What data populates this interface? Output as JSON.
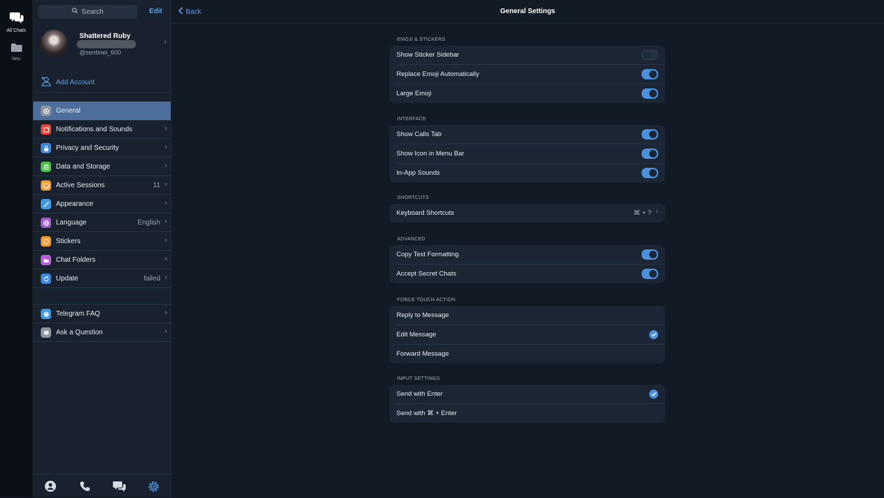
{
  "rail": {
    "all_chats_label": "All Chats",
    "folder_label": "Neu"
  },
  "sidebar": {
    "search_placeholder": "Search",
    "edit_label": "Edit",
    "profile": {
      "name": "Shattered Ruby",
      "username": "@sentinel_600"
    },
    "add_account_label": "Add Account",
    "items": [
      {
        "label": "General",
        "icon": "gear-icon",
        "color": "#8e96a0",
        "value": "",
        "active": true
      },
      {
        "label": "Notifications and Sounds",
        "icon": "bell-icon",
        "color": "#e5473d",
        "value": ""
      },
      {
        "label": "Privacy and Security",
        "icon": "lock-icon",
        "color": "#3d86e0",
        "value": ""
      },
      {
        "label": "Data and Storage",
        "icon": "database-icon",
        "color": "#4cc24a",
        "value": ""
      },
      {
        "label": "Active Sessions",
        "icon": "monitor-icon",
        "color": "#f29b2e",
        "value": "11"
      },
      {
        "label": "Appearance",
        "icon": "brush-icon",
        "color": "#3f9be0",
        "value": ""
      },
      {
        "label": "Language",
        "icon": "globe-icon",
        "color": "#a55ccf",
        "value": "English"
      },
      {
        "label": "Stickers",
        "icon": "sticker-icon",
        "color": "#f29b2e",
        "value": ""
      },
      {
        "label": "Chat Folders",
        "icon": "folder-icon",
        "color": "#b65fd6",
        "value": ""
      },
      {
        "label": "Update",
        "icon": "refresh-icon",
        "color": "#3d86e0",
        "value": "failed"
      }
    ],
    "help_items": [
      {
        "label": "Telegram FAQ",
        "icon": "question-icon",
        "color": "#3f9be0"
      },
      {
        "label": "Ask a Question",
        "icon": "chat-bubble-icon",
        "color": "#8e96a0"
      }
    ]
  },
  "header": {
    "back_label": "Back",
    "title": "General Settings"
  },
  "sections": {
    "emoji": {
      "title": "EMOJI & STICKERS",
      "rows": [
        {
          "label": "Show Sticker Sidebar",
          "on": false
        },
        {
          "label": "Replace Emoji Automatically",
          "on": true
        },
        {
          "label": "Large Emoji",
          "on": true
        }
      ]
    },
    "interface": {
      "title": "INTERFACE",
      "rows": [
        {
          "label": "Show Calls Tab",
          "on": true
        },
        {
          "label": "Show Icon in Menu Bar",
          "on": true
        },
        {
          "label": "In-App Sounds",
          "on": true
        }
      ]
    },
    "shortcuts": {
      "title": "SHORTCUTS",
      "row_label": "Keyboard Shortcuts",
      "row_value": "⌘ + ?"
    },
    "advanced": {
      "title": "ADVANCED",
      "rows": [
        {
          "label": "Copy Text Formatting",
          "on": true
        },
        {
          "label": "Accept Secret Chats",
          "on": true
        }
      ]
    },
    "force_touch": {
      "title": "FORCE TOUCH ACTION",
      "rows": [
        {
          "label": "Reply to Message",
          "checked": false
        },
        {
          "label": "Edit Message",
          "checked": true
        },
        {
          "label": "Forward Message",
          "checked": false
        }
      ]
    },
    "input": {
      "title": "INPUT SETTINGS",
      "rows": [
        {
          "label": "Send with Enter",
          "checked": true
        },
        {
          "label": "Send with ⌘ + Enter",
          "checked": false
        }
      ]
    }
  },
  "colors": {
    "accent": "#4a91df",
    "active_row": "#4e6f9c",
    "panel": "#18212d",
    "card": "#1b2533"
  }
}
